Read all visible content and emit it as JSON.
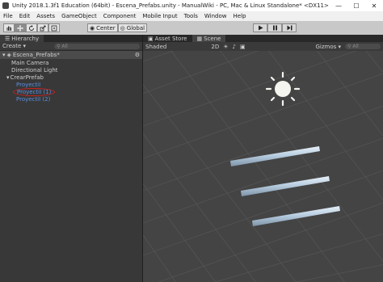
{
  "window": {
    "title": "Unity 2018.1.3f1 Education (64bit) - Escena_Prefabs.unity - ManualWiki - PC, Mac & Linux Standalone* <DX11>"
  },
  "menu": [
    "File",
    "Edit",
    "Assets",
    "GameObject",
    "Component",
    "Mobile Input",
    "Tools",
    "Window",
    "Help"
  ],
  "toolbar": {
    "transform_tools": [
      "hand-icon",
      "move-icon",
      "rotate-icon",
      "scale-icon",
      "rect-tool-icon"
    ],
    "pivot": "Center",
    "space": "Global",
    "play_controls": [
      "play-icon",
      "pause-icon",
      "step-icon"
    ]
  },
  "hierarchy": {
    "tab": "Hierarchy",
    "create": "Create",
    "search_placeholder": "All",
    "scene_name": "Escena_Prefabs*",
    "items": [
      {
        "label": "Main Camera",
        "indent": 1,
        "color": "default"
      },
      {
        "label": "Directional Light",
        "indent": 1,
        "color": "default"
      },
      {
        "label": "CrearPrefab",
        "indent": 1,
        "color": "default",
        "expanded": true
      },
      {
        "label": "ProyectiI",
        "indent": 2,
        "color": "#5a8fe0"
      },
      {
        "label": "ProyectiI (1)",
        "indent": 2,
        "color": "#5a8fe0",
        "circled": true
      },
      {
        "label": "ProyectiI (2)",
        "indent": 2,
        "color": "#5a8fe0"
      }
    ]
  },
  "scene": {
    "tabs": [
      {
        "label": "Asset Store",
        "icon": "asset-store-icon",
        "selected": false
      },
      {
        "label": "Scene",
        "icon": "scene-icon",
        "selected": true
      }
    ],
    "shading": "Shaded",
    "mode_2d": "2D",
    "gizmos": "Gizmos",
    "search_placeholder": "All"
  },
  "colors": {
    "accent_blue": "#5a8fe0",
    "highlight_red": "#d02020",
    "sun": "#f5f5f0",
    "bar": "#b8cde0"
  }
}
